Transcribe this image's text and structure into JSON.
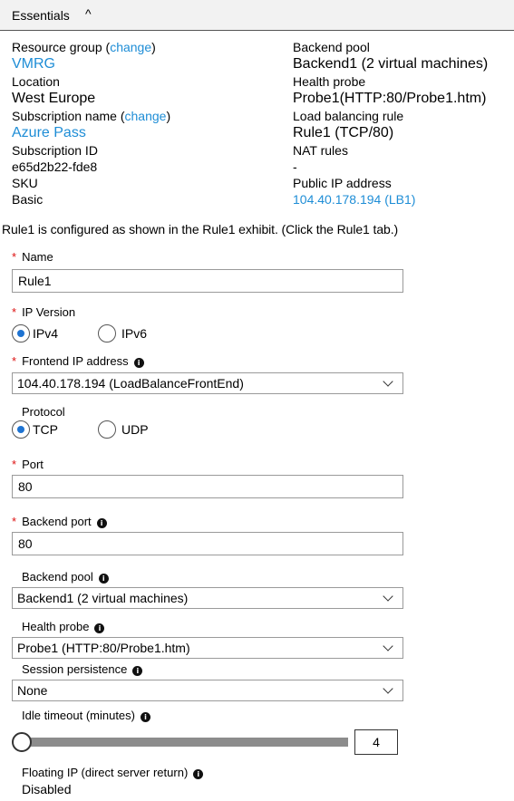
{
  "essentials": {
    "title": "Essentials",
    "caret": "^",
    "left": {
      "resource_group_label": "Resource group",
      "change1": "change",
      "resource_group_value": "VMRG",
      "location_label": "Location",
      "location_value": "West Europe",
      "subscription_name_label": "Subscription name",
      "change2": "change",
      "subscription_name_value": "Azure Pass",
      "subscription_id_label": "Subscription ID",
      "subscription_id_value": "e65d2b22-fde8",
      "sku_label": "SKU",
      "sku_value": "Basic"
    },
    "right": {
      "backend_pool_label": "Backend pool",
      "backend_pool_value": "Backend1 (2 virtual machines)",
      "health_probe_label": "Health probe",
      "health_probe_value": "Probe1(HTTP:80/Probe1.htm)",
      "lb_rule_label": "Load balancing rule",
      "lb_rule_value": "Rule1 (TCP/80)",
      "nat_rules_label": "NAT rules",
      "nat_rules_value": "-",
      "public_ip_label": "Public IP address",
      "public_ip_value": "104.40.178.194 (LB1)"
    }
  },
  "caption": "Rule1 is configured as shown in the Rule1 exhibit. (Click the Rule1 tab.)",
  "form": {
    "required_mark": "*",
    "info_glyph": "i",
    "name": {
      "label": "Name",
      "value": "Rule1"
    },
    "ip_version": {
      "label": "IP Version",
      "options": [
        "IPv4",
        "IPv6"
      ],
      "selected": "IPv4"
    },
    "frontend_ip": {
      "label": "Frontend IP address",
      "value": "104.40.178.194 (LoadBalanceFrontEnd)"
    },
    "protocol": {
      "label": "Protocol",
      "options": [
        "TCP",
        "UDP"
      ],
      "selected": "TCP"
    },
    "port": {
      "label": "Port",
      "value": "80"
    },
    "backend_port": {
      "label": "Backend port",
      "value": "80"
    },
    "backend_pool": {
      "label": "Backend pool",
      "value": "Backend1 (2 virtual machines)"
    },
    "health_probe": {
      "label": "Health probe",
      "value": "Probe1 (HTTP:80/Probe1.htm)"
    },
    "session_persistence": {
      "label": "Session persistence",
      "value": "None"
    },
    "idle_timeout": {
      "label": "Idle timeout (minutes)",
      "value": "4"
    },
    "floating_ip": {
      "label": "Floating IP (direct server return)",
      "value": "Disabled"
    }
  },
  "icons": {
    "info": "info-icon",
    "dropdown": "chevron-down-icon",
    "collapse": "caret-up-icon"
  },
  "colors": {
    "link": "#1e8dd6",
    "required": "#dd1111",
    "radio_selected": "#1e73d2",
    "header_bg": "#f2f2f2"
  }
}
